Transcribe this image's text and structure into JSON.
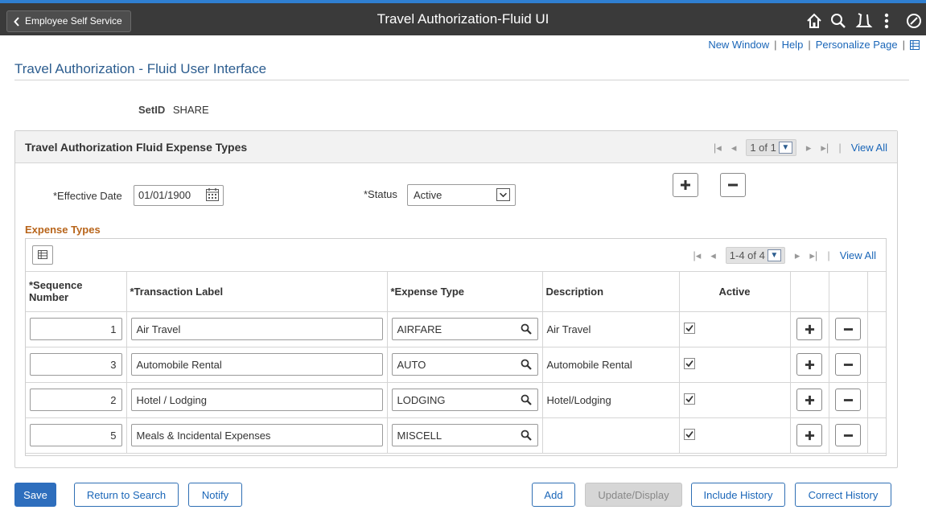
{
  "header": {
    "back_label": "Employee Self Service",
    "title": "Travel Authorization-Fluid UI"
  },
  "links": {
    "new_window": "New Window",
    "help": "Help",
    "personalize": "Personalize Page",
    "separator": "|"
  },
  "page_title": "Travel Authorization - Fluid User Interface",
  "setid": {
    "label": "SetID",
    "value": "SHARE"
  },
  "panel": {
    "title": "Travel Authorization Fluid Expense Types",
    "pager_count": "1 of 1",
    "view_all": "View All",
    "effective_date_label": "*Effective Date",
    "effective_date": "01/01/1900",
    "status_label": "*Status",
    "status_value": "Active"
  },
  "expense_types": {
    "title": "Expense Types",
    "pager_count": "1-4 of 4",
    "view_all": "View All",
    "columns": {
      "sequence": "*Sequence Number",
      "label": "*Transaction Label",
      "expense_type": "*Expense Type",
      "description": "Description",
      "active": "Active"
    },
    "rows": [
      {
        "seq": "1",
        "label": "Air Travel",
        "type": "AIRFARE",
        "desc": "Air Travel",
        "active": true
      },
      {
        "seq": "3",
        "label": "Automobile Rental",
        "type": "AUTO",
        "desc": "Automobile Rental",
        "active": true
      },
      {
        "seq": "2",
        "label": "Hotel / Lodging",
        "type": "LODGING",
        "desc": "Hotel/Lodging",
        "active": true
      },
      {
        "seq": "5",
        "label": "Meals & Incidental Expenses",
        "type": "MISCELL",
        "desc": "",
        "active": true
      }
    ]
  },
  "buttons": {
    "save": "Save",
    "return_to_search": "Return to Search",
    "notify": "Notify",
    "add": "Add",
    "update_display": "Update/Display",
    "include_history": "Include History",
    "correct_history": "Correct History"
  },
  "colors": {
    "accent": "#2f7fd1",
    "header_bg": "#3a3a3a",
    "section_title": "#b8651b",
    "link": "#1a66b8"
  }
}
